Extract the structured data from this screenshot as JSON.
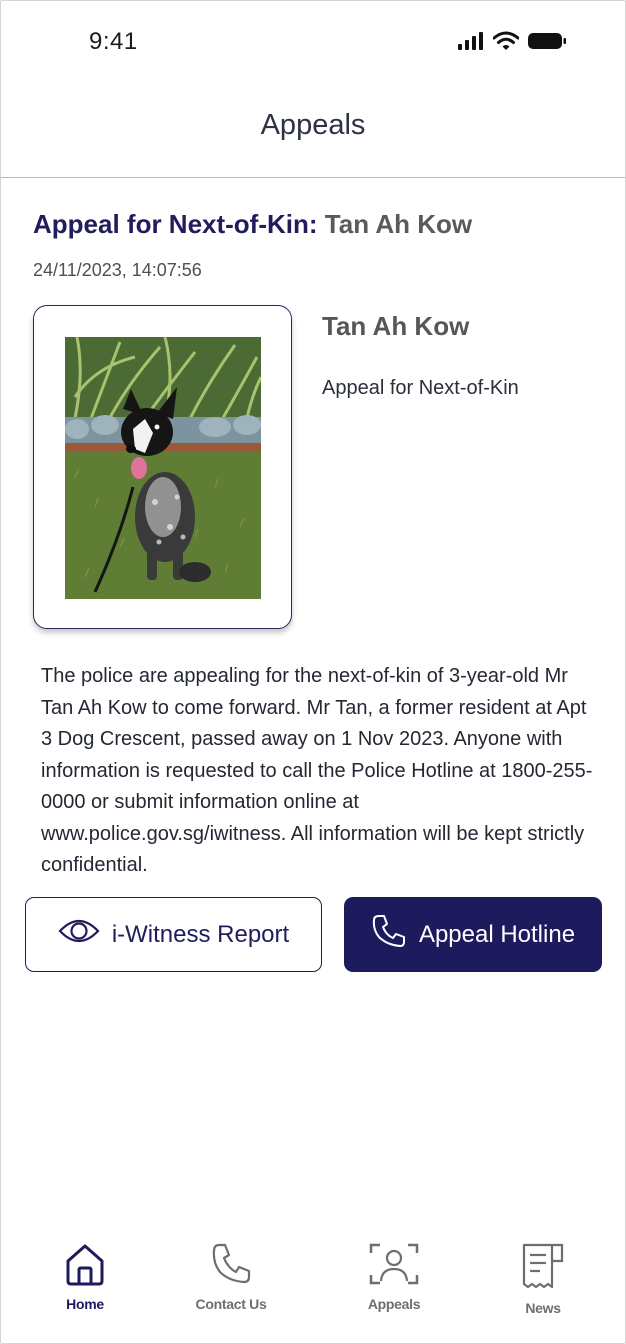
{
  "status_bar": {
    "time": "9:41",
    "icons": [
      "signal-icon",
      "wifi-icon",
      "battery-icon"
    ]
  },
  "header": {
    "title": "Appeals"
  },
  "appeal": {
    "heading_kind": "Appeal for Next-of-Kin:",
    "heading_name": "Tan Ah Kow",
    "timestamp": "24/11/2023, 14:07:56",
    "person_name": "Tan Ah Kow",
    "person_tag": "Appeal for Next-of-Kin",
    "description": "The police are appealing for the next-of-kin of 3-year-old Mr Tan Ah Kow to come forward. Mr Tan, a former resident at Apt 3 Dog Crescent, passed away on 1 Nov 2023. Anyone with information is requested to call the Police Hotline at 1800-255-0000 or submit information online at www.police.gov.sg/iwitness. All information will be kept strictly confidential."
  },
  "actions": {
    "witness_label": "i-Witness Report",
    "witness_icon": "eye-icon",
    "hotline_label": "Appeal Hotline",
    "hotline_icon": "phone-icon"
  },
  "nav": {
    "items": [
      {
        "label": "Home",
        "icon": "home-icon",
        "active": true
      },
      {
        "label": "Contact Us",
        "icon": "phone-icon",
        "active": false
      },
      {
        "label": "Appeals",
        "icon": "person-scan-icon",
        "active": false
      },
      {
        "label": "News",
        "icon": "news-icon",
        "active": false
      }
    ]
  },
  "colors": {
    "brand": "#1e1a5e",
    "muted_text": "#5a5a5a"
  }
}
